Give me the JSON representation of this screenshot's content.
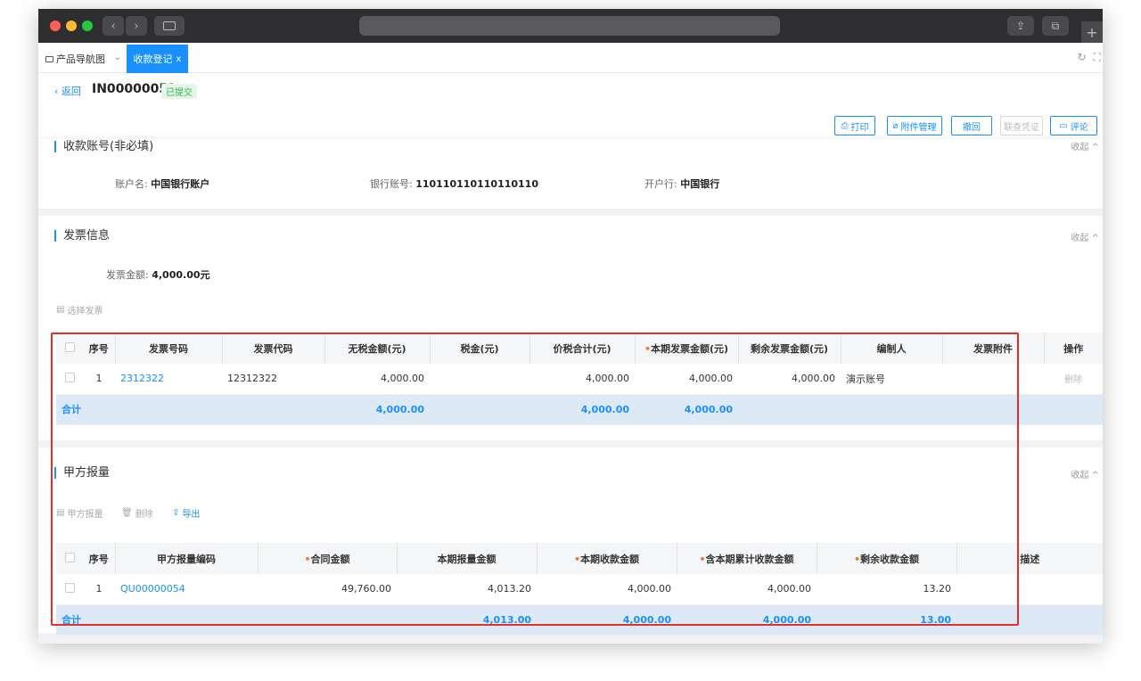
{
  "browser": {
    "colors": {
      "titlebar": "#2e2e30",
      "accent": "#1890ff",
      "highlight": "#e5302a"
    }
  },
  "tabs": {
    "home_label": "产品导航图",
    "active_label": "收款登记",
    "close_glyph": "x"
  },
  "header": {
    "back_label": "返回",
    "doc_no": "IN00000052",
    "status": "已提交"
  },
  "actions": {
    "print": "打印",
    "attachments": "附件管理",
    "withdraw": "撤回",
    "view_voucher": "联查凭证",
    "comment": "评论"
  },
  "account_section": {
    "title": "收款账号(非必填)",
    "collapse": "收起",
    "account_name_label": "账户名:",
    "account_name": "中国银行账户",
    "bank_account_label": "银行账号:",
    "bank_account": "110110110110110110",
    "bank_label": "开户行:",
    "bank": "中国银行"
  },
  "invoice_section": {
    "title": "发票信息",
    "collapse": "收起",
    "amount_label": "发票金额:",
    "amount": "4,000.00元",
    "select_btn": "选择发票",
    "table": {
      "headers": [
        "序号",
        "发票号码",
        "发票代码",
        "无税金额(元)",
        "税金(元)",
        "价税合计(元)",
        "本期发票金额(元)",
        "剩余发票金额(元)",
        "编制人",
        "发票附件",
        "操作"
      ],
      "rows": [
        {
          "idx": "1",
          "number": "2312322",
          "code": "12312322",
          "pretax": "4,000.00",
          "tax": "",
          "total": "4,000.00",
          "current": "4,000.00",
          "remaining": "4,000.00",
          "maker": "演示账号",
          "attachment": "",
          "op": "删除"
        }
      ],
      "sum": {
        "label": "合计",
        "pretax": "4,000.00",
        "total": "4,000.00",
        "current": "4,000.00"
      }
    }
  },
  "quantity_section": {
    "title": "甲方报量",
    "collapse": "收起",
    "toolbar": {
      "add": "甲方报量",
      "delete": "删除",
      "export": "导出"
    },
    "table": {
      "headers": [
        "序号",
        "甲方报量编码",
        "合同金额",
        "本期报量金额",
        "本期收款金额",
        "含本期累计收款金额",
        "剩余收款金额",
        "描述"
      ],
      "rows": [
        {
          "idx": "1",
          "code": "QU00000054",
          "contract": "49,760.00",
          "reported": "4,013.20",
          "received": "4,000.00",
          "cumulative": "4,000.00",
          "remaining": "13.20",
          "desc": ""
        }
      ],
      "sum": {
        "label": "合计",
        "reported": "4,013.00",
        "received": "4,000.00",
        "cumulative": "4,000.00",
        "remaining": "13.00"
      }
    }
  }
}
